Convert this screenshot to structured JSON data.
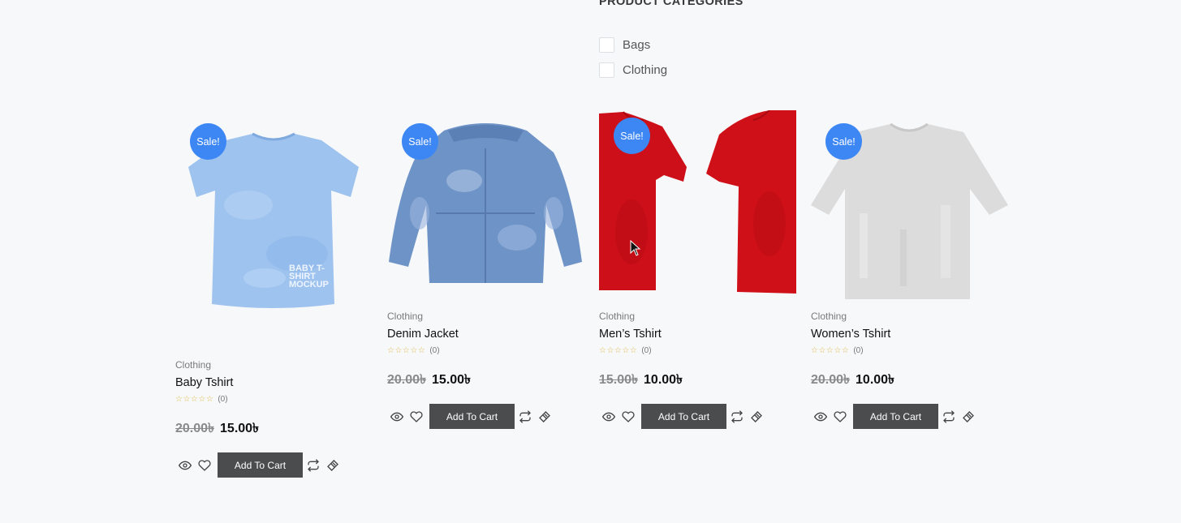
{
  "filter": {
    "heading": "PRODUCT CATEGORIES",
    "options": [
      {
        "label": "Bags",
        "checked": false
      },
      {
        "label": "Clothing",
        "checked": false
      }
    ]
  },
  "products": [
    {
      "badge": "Sale!",
      "category": "Clothing",
      "title": "Baby Tshirt",
      "stars": "☆☆☆☆☆",
      "rating_count": "(0)",
      "old_price": "20.00৳",
      "new_price": "15.00৳",
      "cart_label": "Add To Cart",
      "image_label": "BABY T-SHIRT MOCKUP"
    },
    {
      "badge": "Sale!",
      "category": "Clothing",
      "title": "Denim Jacket",
      "stars": "☆☆☆☆☆",
      "rating_count": "(0)",
      "old_price": "20.00৳",
      "new_price": "15.00৳",
      "cart_label": "Add To Cart"
    },
    {
      "badge": "Sale!",
      "category": "Clothing",
      "title": "Men’s Tshirt",
      "stars": "☆☆☆☆☆",
      "rating_count": "(0)",
      "old_price": "15.00৳",
      "new_price": "10.00৳",
      "cart_label": "Add To Cart"
    },
    {
      "badge": "Sale!",
      "category": "Clothing",
      "title": "Women’s Tshirt",
      "stars": "☆☆☆☆☆",
      "rating_count": "(0)",
      "old_price": "20.00৳",
      "new_price": "10.00৳",
      "cart_label": "Add To Cart"
    }
  ],
  "icons": {
    "quick_view": "eye-icon",
    "wishlist": "heart-icon",
    "compare": "compare-arrows-icon",
    "tag": "tag-icon",
    "cursor": "mouse-pointer-icon"
  },
  "colors": {
    "badge": "#3d87f5",
    "cart_button": "#4a4c4e",
    "background": "#f7f8fa"
  }
}
